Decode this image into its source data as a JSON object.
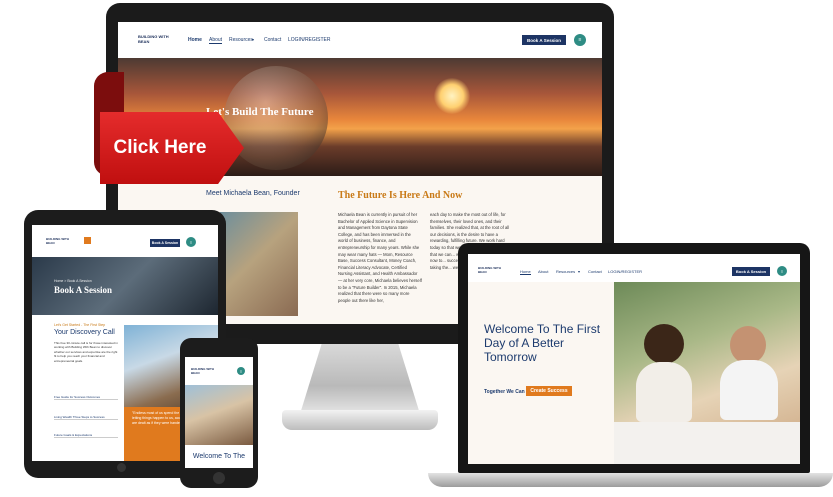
{
  "colors": {
    "navy": "#1d3464",
    "orange": "#e07a1e",
    "red": "#d61a1a",
    "teal": "#2e8c84"
  },
  "cta": {
    "label": "Click Here"
  },
  "desktop": {
    "logo": "BUILDING WITH BEAN",
    "nav": [
      "Home",
      "About",
      "Resources",
      "Contact",
      "LOGIN/REGISTER"
    ],
    "book_button": "Book A Session",
    "hero_title": "Let's Build The Future",
    "meet": "Meet Michaela Bean, Founder",
    "future_heading": "The Future Is Here And Now",
    "col1": "Michaela Bean is currently in pursuit of her Bachelor of Applied Science in Supervision and Management from Daytona State College, and has been immersed in the world of business, finance, and entrepreneurship for many years. While she may wear many hats — Mom, Resource Base, Success Consultant, Money Coach, Financial Literacy Advocate, Certified Nursing Assistant, and Health Ambassador — at her very core, Michaela believes herself to be a \"Future Builder\". In 2015, Michaela realized that there were so many more people out there like her,",
    "col2": "each day to make the most out of life, for themselves, their loved ones, and their families. She realized that, at the root of all our decisions, is the desire to have a rewarding, fulfilling future. We work hard today so that we can... later, we invest so that we can... we plan now so that... study now to... succeed in... another... we... by taking the... we have the... the future th..."
  },
  "tablet": {
    "breadcrumb": "Home  >  Book A Session",
    "title": "Book A Session",
    "eyebrow": "Let's Get Started - The First Step",
    "heading": "Your Discovery Call",
    "paragraph": "This free 30-minute call is for those interested in working with Building With Bean to discover whether our services and expertise are the right fit to help you reach your financial and entrepreneurial goals.",
    "links": [
      "Free Guide for Success Outcomes",
      "Living Wealth Three Steps to Success",
      "Future Goals & Expectations"
    ],
    "quote": "\"Endless most of us spend the majority of our lives letting things happen to us, accepting the cards we are dealt as if they were handed to us.\""
  },
  "phone": {
    "logo": "BUILDING WITH BEAN",
    "welcome": "Welcome To The"
  },
  "laptop": {
    "logo": "BUILDING WITH BEAN",
    "nav": [
      "Home",
      "About",
      "Resources",
      "Contact",
      "LOGIN/REGISTER"
    ],
    "book_button": "Book A Session",
    "welcome": "Welcome To The First Day of A Better Tomorrow",
    "together": "Together We Can",
    "create_button": "Create Success"
  }
}
